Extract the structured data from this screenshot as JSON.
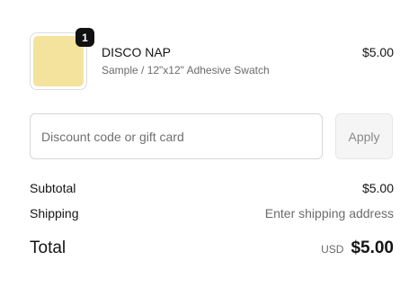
{
  "line_item": {
    "quantity": "1",
    "name": "DISCO NAP",
    "variant": "Sample / 12\"x12\" Adhesive Swatch",
    "price": "$5.00",
    "swatch_color": "#f4e39d"
  },
  "discount": {
    "placeholder": "Discount code or gift card",
    "value": "",
    "apply_label": "Apply"
  },
  "totals": {
    "subtotal_label": "Subtotal",
    "subtotal_value": "$5.00",
    "shipping_label": "Shipping",
    "shipping_value": "Enter shipping address",
    "total_label": "Total",
    "currency": "USD",
    "total_value": "$5.00"
  }
}
